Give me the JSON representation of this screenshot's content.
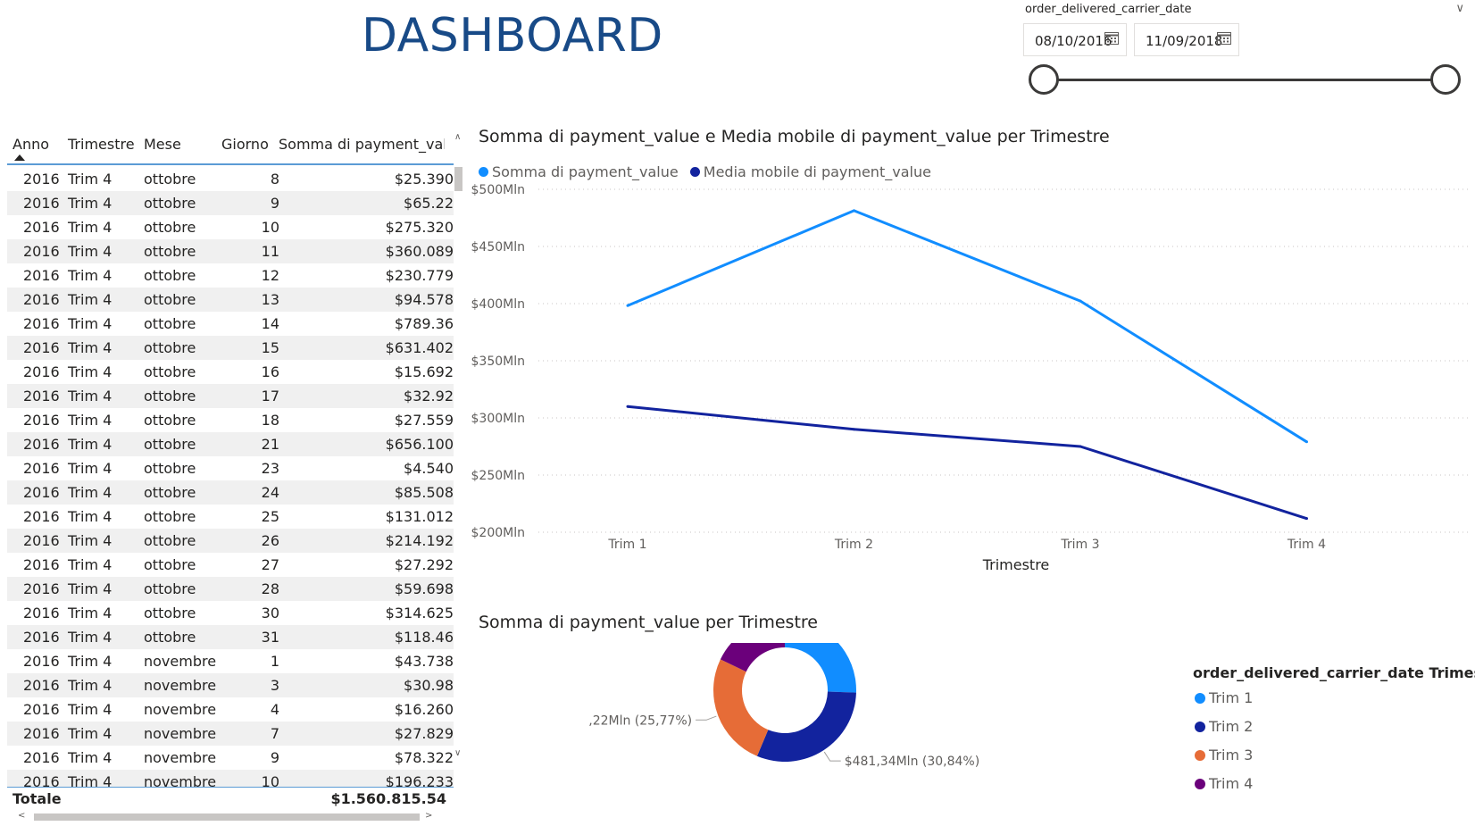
{
  "page_title": "DASHBOARD",
  "slicer": {
    "field": "order_delivered_carrier_date",
    "start_date": "08/10/2016",
    "end_date": "11/09/2018"
  },
  "table": {
    "columns": [
      "Anno",
      "Trimestre",
      "Mese",
      "Giorno",
      "Somma di payment_value"
    ],
    "rows": [
      [
        "2016",
        "Trim 4",
        "ottobre",
        "8",
        "$25.390"
      ],
      [
        "2016",
        "Trim 4",
        "ottobre",
        "9",
        "$65.22"
      ],
      [
        "2016",
        "Trim 4",
        "ottobre",
        "10",
        "$275.320"
      ],
      [
        "2016",
        "Trim 4",
        "ottobre",
        "11",
        "$360.089"
      ],
      [
        "2016",
        "Trim 4",
        "ottobre",
        "12",
        "$230.779"
      ],
      [
        "2016",
        "Trim 4",
        "ottobre",
        "13",
        "$94.578"
      ],
      [
        "2016",
        "Trim 4",
        "ottobre",
        "14",
        "$789.36"
      ],
      [
        "2016",
        "Trim 4",
        "ottobre",
        "15",
        "$631.402"
      ],
      [
        "2016",
        "Trim 4",
        "ottobre",
        "16",
        "$15.692"
      ],
      [
        "2016",
        "Trim 4",
        "ottobre",
        "17",
        "$32.92"
      ],
      [
        "2016",
        "Trim 4",
        "ottobre",
        "18",
        "$27.559"
      ],
      [
        "2016",
        "Trim 4",
        "ottobre",
        "21",
        "$656.100"
      ],
      [
        "2016",
        "Trim 4",
        "ottobre",
        "23",
        "$4.540"
      ],
      [
        "2016",
        "Trim 4",
        "ottobre",
        "24",
        "$85.508"
      ],
      [
        "2016",
        "Trim 4",
        "ottobre",
        "25",
        "$131.012"
      ],
      [
        "2016",
        "Trim 4",
        "ottobre",
        "26",
        "$214.192"
      ],
      [
        "2016",
        "Trim 4",
        "ottobre",
        "27",
        "$27.292"
      ],
      [
        "2016",
        "Trim 4",
        "ottobre",
        "28",
        "$59.698"
      ],
      [
        "2016",
        "Trim 4",
        "ottobre",
        "30",
        "$314.625"
      ],
      [
        "2016",
        "Trim 4",
        "ottobre",
        "31",
        "$118.46"
      ],
      [
        "2016",
        "Trim 4",
        "novembre",
        "1",
        "$43.738"
      ],
      [
        "2016",
        "Trim 4",
        "novembre",
        "3",
        "$30.98"
      ],
      [
        "2016",
        "Trim 4",
        "novembre",
        "4",
        "$16.260"
      ],
      [
        "2016",
        "Trim 4",
        "novembre",
        "7",
        "$27.829"
      ],
      [
        "2016",
        "Trim 4",
        "novembre",
        "9",
        "$78.322"
      ],
      [
        "2016",
        "Trim 4",
        "novembre",
        "10",
        "$196.233"
      ]
    ],
    "total_label": "Totale",
    "total_value": "$1.560.815.54"
  },
  "line_chart": {
    "title": "Somma di payment_value e Media mobile di payment_value per Trimestre",
    "y_tick_labels": [
      "$500Mln",
      "$450Mln",
      "$400Mln",
      "$350Mln",
      "$300Mln",
      "$250Mln",
      "$200Mln"
    ]
  },
  "donut_chart": {
    "title": "Somma di payment_value per Trimestre",
    "legend_title": "order_delivered_carrier_date Trimestre"
  },
  "chart_data": [
    {
      "type": "line",
      "title": "Somma di payment_value e Media mobile di payment_value per Trimestre",
      "categories": [
        "Trim 1",
        "Trim 2",
        "Trim 3",
        "Trim 4"
      ],
      "series": [
        {
          "name": "Somma di payment_value",
          "color": "#118dff",
          "values": [
            398.2,
            481.34,
            402.22,
            279.06
          ]
        },
        {
          "name": "Media mobile di payment_value",
          "color": "#12239e",
          "values": [
            310,
            290,
            275,
            212
          ]
        }
      ],
      "xlabel": "Trimestre",
      "ylabel": "Somma di payment_value e Media mobile di pay...",
      "ylim": [
        200,
        500
      ],
      "y_unit": "Mln",
      "grid": true,
      "legend": "top-left"
    },
    {
      "type": "pie",
      "title": "Somma di payment_value per Trimestre",
      "slices": [
        {
          "label": "Trim 1",
          "value": 398.2,
          "display": "$398,2Mln (25,51%)",
          "color": "#118dff"
        },
        {
          "label": "Trim 2",
          "value": 481.34,
          "display": "$481,34Mln (30,84%)",
          "color": "#12239e"
        },
        {
          "label": "Trim 3",
          "value": 402.22,
          "display": "$402,22Mln (25,77%)",
          "color": "#e66c37"
        },
        {
          "label": "Trim 4",
          "value": 279.06,
          "display": "$279,06Mln (17,88%)",
          "color": "#6b007b"
        }
      ],
      "legend_title": "order_delivered_carrier_date Trimestre",
      "legend": "right"
    }
  ]
}
